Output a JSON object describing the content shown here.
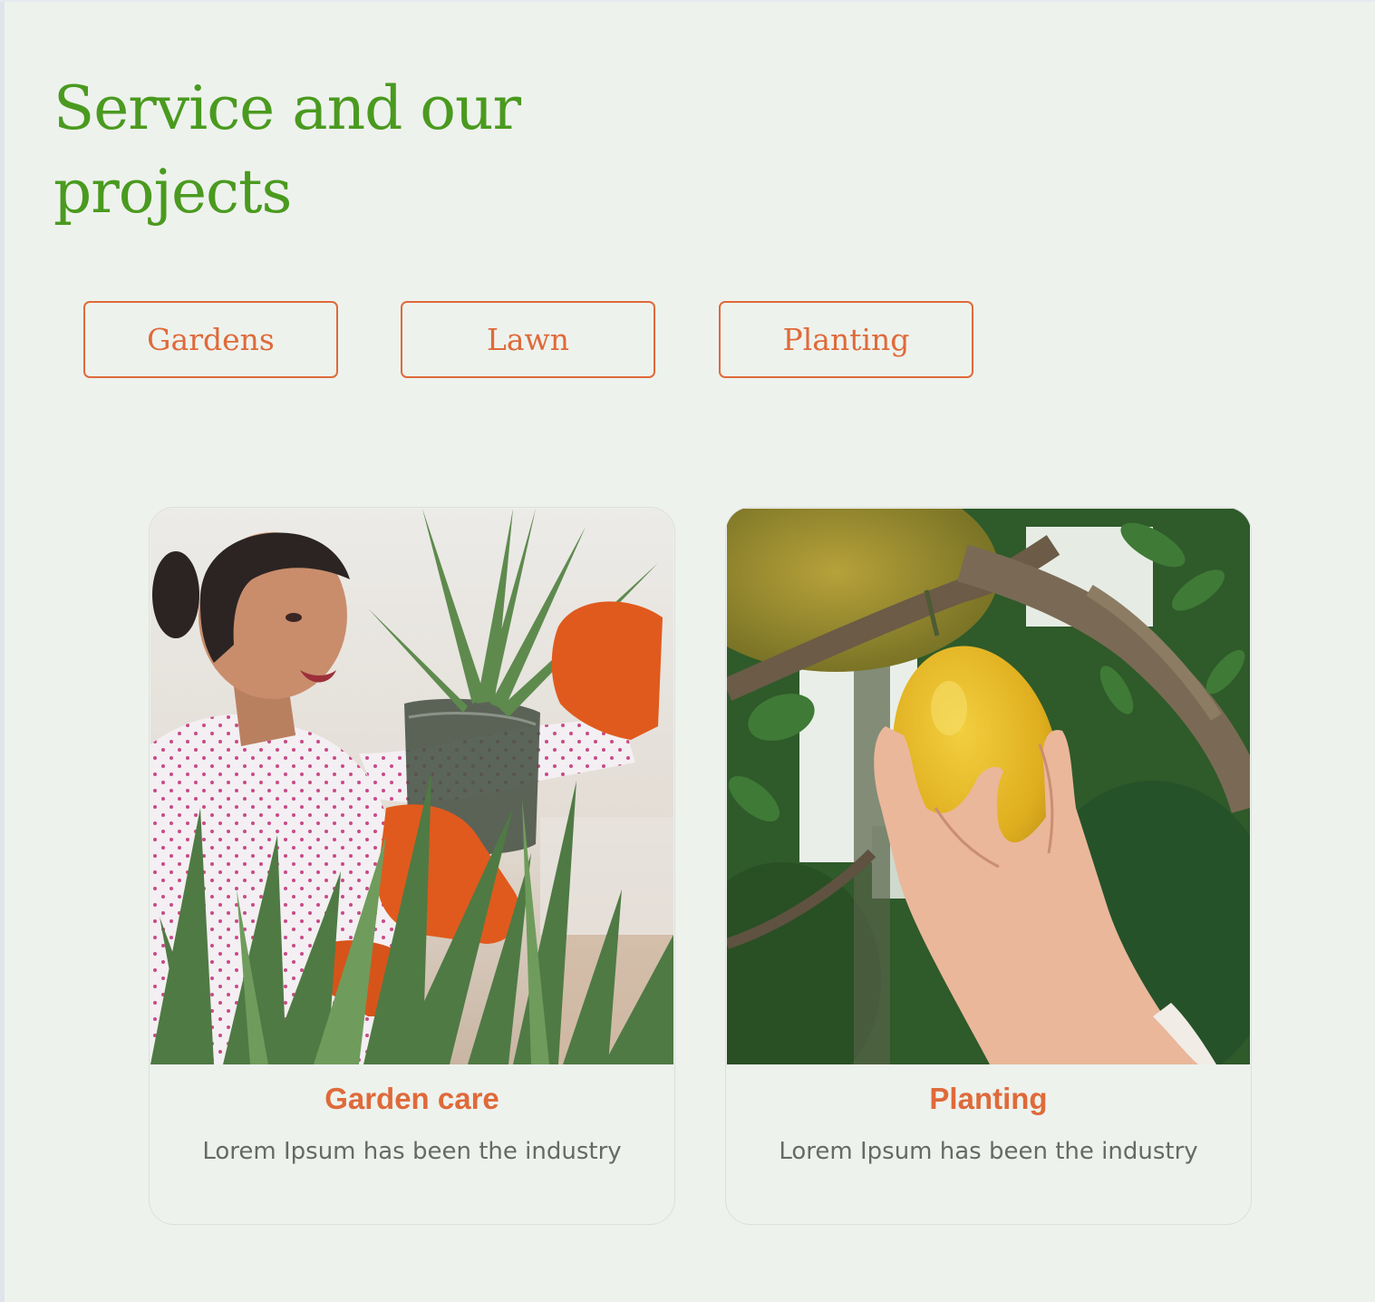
{
  "section": {
    "title": "Service and our projects"
  },
  "tabs": [
    {
      "label": "Gardens"
    },
    {
      "label": "Lawn"
    },
    {
      "label": "Planting"
    }
  ],
  "cards": [
    {
      "title": "Garden care",
      "description": "Lorem Ipsum has been the industry",
      "image": "woman-with-aloe-plants-photo"
    },
    {
      "title": "Planting",
      "description": "Lorem Ipsum has been the industry",
      "image": "hand-holding-lemon-on-branch-photo"
    }
  ],
  "colors": {
    "background": "#eef2ed",
    "title_green": "#4a9a1f",
    "accent_orange": "#df6a3a",
    "text_gray": "#666a66"
  }
}
